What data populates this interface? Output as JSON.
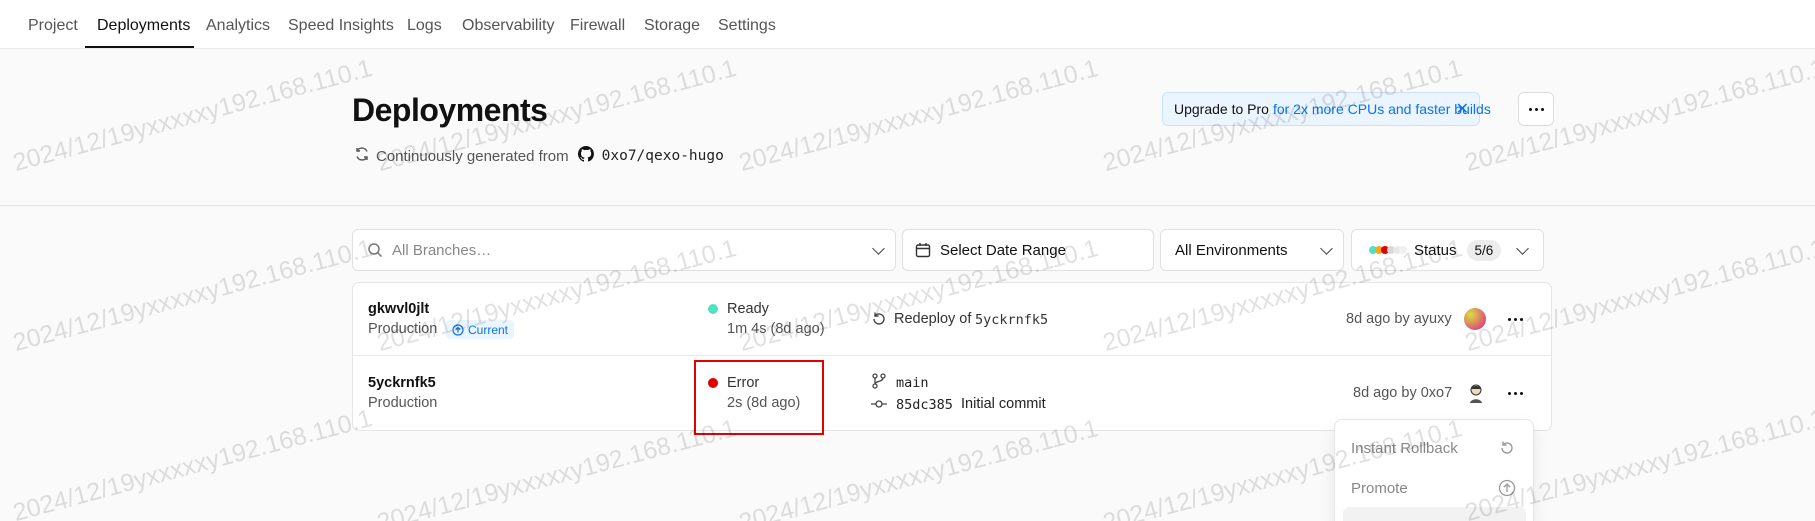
{
  "nav": {
    "tabs": [
      "Project",
      "Deployments",
      "Analytics",
      "Speed Insights",
      "Logs",
      "Observability",
      "Firewall",
      "Storage",
      "Settings"
    ],
    "active": "Deployments"
  },
  "header": {
    "title": "Deployments",
    "generated_label": "Continuously generated from",
    "repo": "0xo7/qexo-hugo",
    "upgrade_strong": "Upgrade to Pro",
    "upgrade_text": "for 2x more CPUs and faster builds"
  },
  "filters": {
    "branches_placeholder": "All Branches…",
    "date_range": "Select Date Range",
    "environments": "All Environments",
    "status_label": "Status",
    "status_count": "5/6"
  },
  "deployments": [
    {
      "id": "gkwvl0jlt",
      "environment": "Production",
      "current_badge": "Current",
      "status": "Ready",
      "duration": "1m 4s (8d ago)",
      "source_prefix": "Redeploy of",
      "source_ref": "5yckrnfk5",
      "meta": "8d ago by ayuxy",
      "status_color": "#50e3c2"
    },
    {
      "id": "5yckrnfk5",
      "environment": "Production",
      "status": "Error",
      "duration": "2s (8d ago)",
      "branch": "main",
      "commit": "85dc385",
      "commit_message": "Initial commit",
      "meta": "8d ago by 0xo7",
      "status_color": "#e00000"
    }
  ],
  "menu": {
    "items": [
      "Instant Rollback",
      "Promote"
    ]
  },
  "watermark": "2024/12/19yxxxxxy192.168.110.1",
  "colors": {
    "accent_blue": "#0a72ef",
    "error_red": "#e00000",
    "ready_green": "#50e3c2"
  }
}
